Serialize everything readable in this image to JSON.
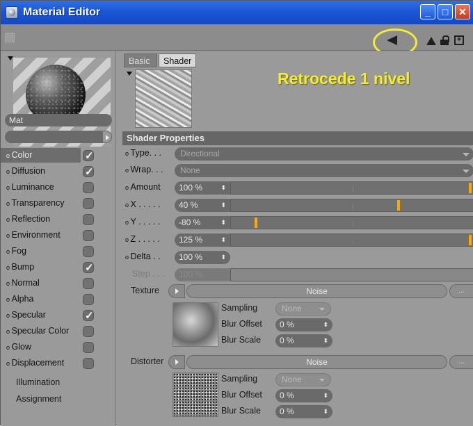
{
  "window": {
    "title": "Material Editor"
  },
  "annotation": {
    "text": "Retrocede 1 nivel",
    "color": "#f3ea3b"
  },
  "material": {
    "name": "Mat"
  },
  "channels": [
    {
      "label": "Color",
      "checked": true,
      "selected": true
    },
    {
      "label": "Diffusion",
      "checked": true
    },
    {
      "label": "Luminance",
      "checked": false
    },
    {
      "label": "Transparency",
      "checked": false
    },
    {
      "label": "Reflection",
      "checked": false
    },
    {
      "label": "Environment",
      "checked": false
    },
    {
      "label": "Fog",
      "checked": false
    },
    {
      "label": "Bump",
      "checked": true
    },
    {
      "label": "Normal",
      "checked": false
    },
    {
      "label": "Alpha",
      "checked": false
    },
    {
      "label": "Specular",
      "checked": true
    },
    {
      "label": "Specular Color",
      "checked": false
    },
    {
      "label": "Glow",
      "checked": false
    },
    {
      "label": "Displacement",
      "checked": false
    }
  ],
  "extra_items": [
    "Illumination",
    "Assignment"
  ],
  "tabs": {
    "basic": "Basic",
    "shader": "Shader"
  },
  "shader": {
    "section_title": "Shader Properties",
    "type": {
      "label": "Type",
      "value": "Directional"
    },
    "wrap": {
      "label": "Wrap",
      "value": "None"
    },
    "amount": {
      "label": "Amount",
      "value": "100 %",
      "knob": 1.0
    },
    "x": {
      "label": "X",
      "value": "40 %",
      "knob": 0.7
    },
    "y": {
      "label": "Y",
      "value": "-80 %",
      "knob": 0.1
    },
    "z": {
      "label": "Z",
      "value": "125 %",
      "knob": 1.0
    },
    "delta": {
      "label": "Delta",
      "value": "100 %"
    },
    "step": {
      "label": "Step",
      "value": "100 %"
    }
  },
  "texture": {
    "label": "Texture",
    "name": "Noise",
    "more": "...",
    "sampling": {
      "label": "Sampling",
      "value": "None"
    },
    "blur_offset": {
      "label": "Blur Offset",
      "value": "0 %"
    },
    "blur_scale": {
      "label": "Blur Scale",
      "value": "0 %"
    }
  },
  "distorter": {
    "label": "Distorter",
    "name": "Noise",
    "more": "...",
    "sampling": {
      "label": "Sampling",
      "value": "None"
    },
    "blur_offset": {
      "label": "Blur Offset",
      "value": "0 %"
    },
    "blur_scale": {
      "label": "Blur Scale",
      "value": "0 %"
    }
  }
}
